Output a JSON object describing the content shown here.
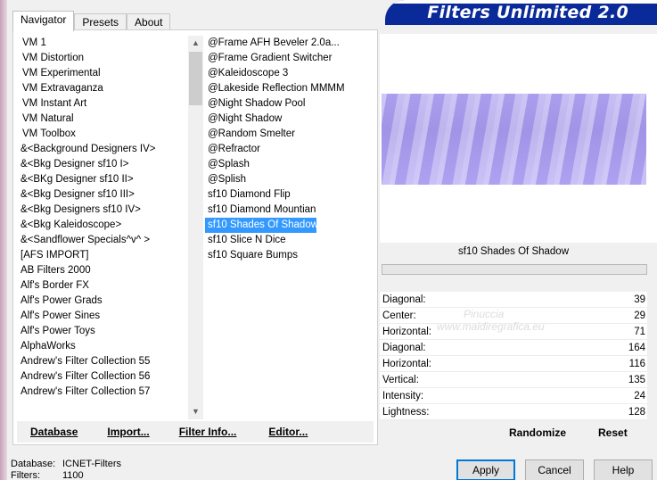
{
  "app": {
    "title": "Filters Unlimited 2.0"
  },
  "tabs": [
    {
      "label": "Navigator",
      "active": true
    },
    {
      "label": "Presets",
      "active": false
    },
    {
      "label": "About",
      "active": false
    }
  ],
  "categories": [
    "VM 1",
    "VM Distortion",
    "VM Experimental",
    "VM Extravaganza",
    "VM Instant Art",
    "VM Natural",
    "VM Toolbox",
    "&<Background Designers IV>",
    "&<Bkg Designer sf10 I>",
    "&<BKg Designer sf10 II>",
    "&<Bkg Designer sf10 III>",
    "&<Bkg Designers sf10 IV>",
    "&<Bkg Kaleidoscope>",
    "&<Sandflower Specials^v^ >",
    "[AFS IMPORT]",
    "AB Filters 2000",
    "Alf's Border FX",
    "Alf's Power Grads",
    "Alf's Power Sines",
    "Alf's Power Toys",
    "AlphaWorks",
    "Andrew's Filter Collection 55",
    "Andrew's Filter Collection 56",
    "Andrew's Filter Collection 57"
  ],
  "filters": [
    {
      "label": "@Frame AFH Beveler 2.0a...",
      "selected": false
    },
    {
      "label": "@Frame Gradient Switcher",
      "selected": false
    },
    {
      "label": "@Kaleidoscope 3",
      "selected": false
    },
    {
      "label": "@Lakeside Reflection MMMM",
      "selected": false
    },
    {
      "label": "@Night Shadow Pool",
      "selected": false
    },
    {
      "label": "@Night Shadow",
      "selected": false
    },
    {
      "label": "@Random Smelter",
      "selected": false
    },
    {
      "label": "@Refractor",
      "selected": false
    },
    {
      "label": "@Splash",
      "selected": false
    },
    {
      "label": "@Splish",
      "selected": false
    },
    {
      "label": "sf10 Diamond Flip",
      "selected": false
    },
    {
      "label": "sf10 Diamond Mountian",
      "selected": false
    },
    {
      "label": "sf10 Shades Of Shadow",
      "selected": true
    },
    {
      "label": "sf10 Slice N Dice",
      "selected": false
    },
    {
      "label": "sf10 Square Bumps",
      "selected": false
    }
  ],
  "bottom_buttons": {
    "database": "Database",
    "import": "Import...",
    "filter_info": "Filter Info...",
    "editor": "Editor..."
  },
  "preview": {
    "filter_name": "sf10 Shades Of Shadow"
  },
  "params": [
    {
      "label": "Diagonal:",
      "value": "39"
    },
    {
      "label": "Center:",
      "value": "29"
    },
    {
      "label": "Horizontal:",
      "value": "71"
    },
    {
      "label": "Diagonal:",
      "value": "164"
    },
    {
      "label": "Horizontal:",
      "value": "116"
    },
    {
      "label": "Vertical:",
      "value": "135"
    },
    {
      "label": "Intensity:",
      "value": "24"
    },
    {
      "label": "Lightness:",
      "value": "128"
    }
  ],
  "randomize_label": "Randomize",
  "reset_label": "Reset",
  "status": {
    "database_label": "Database:",
    "database_value": "ICNET-Filters",
    "filters_label": "Filters:",
    "filters_value": "1100"
  },
  "dialog_buttons": {
    "apply": "Apply",
    "cancel": "Cancel",
    "help": "Help"
  },
  "watermark": {
    "line1": "Pinuccia",
    "line2": "www.maidiregrafica.eu"
  },
  "colors": {
    "banner": "#0b2a9a",
    "selection": "#3399ff",
    "preview": "#b0a4ee"
  }
}
